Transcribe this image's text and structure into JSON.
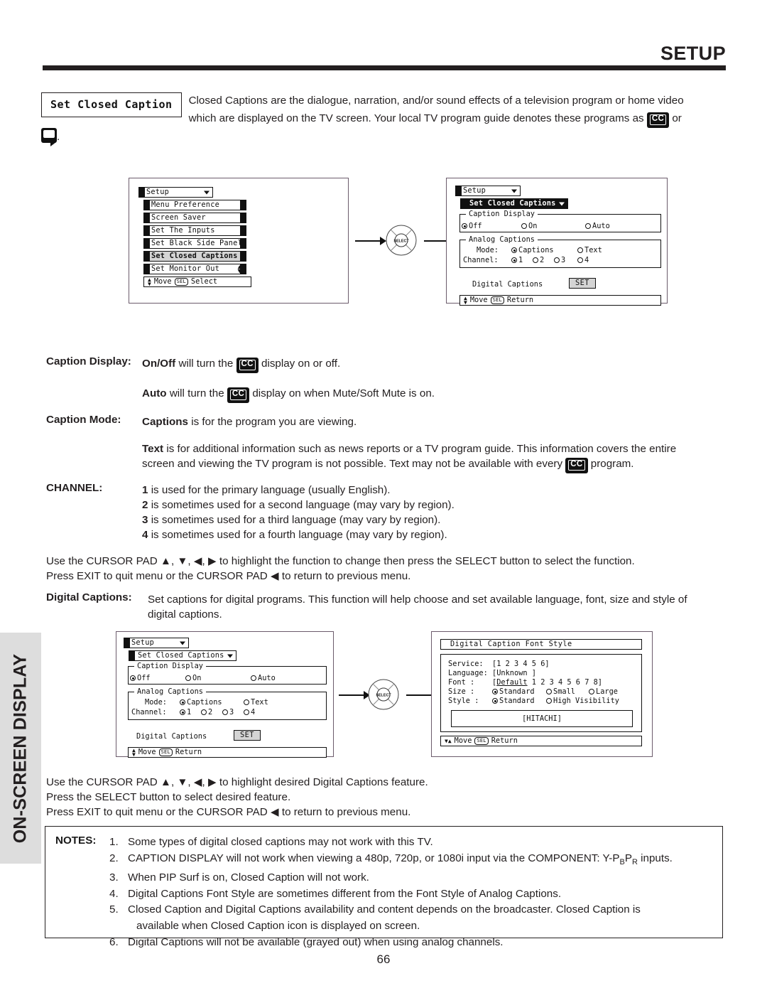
{
  "header": {
    "title": "SETUP"
  },
  "side_tab": {
    "label": "ON-SCREEN DISPLAY"
  },
  "page_number": "66",
  "intro": {
    "tag_label": "Set Closed Caption",
    "line1": "Closed Captions are the dialogue, narration, and/or sound effects of a television program or home video",
    "line2_a": "which are displayed on the TV screen.  Your local TV program guide denotes these programs as",
    "cc_badge": "CC",
    "line2_b": "or",
    "line3_b": "."
  },
  "diagram1": {
    "menu": {
      "title": "Setup",
      "items": [
        "Menu Preference",
        "Screen Saver",
        "Set The Inputs",
        "Set Black Side Panel",
        "Set Closed Captions",
        "Set Monitor Out"
      ],
      "selected_item": "Set Closed Captions",
      "footer_move": "Move",
      "footer_key": "SEL",
      "footer_action": "Select"
    },
    "pad_label": "SELECT"
  },
  "diagram2": {
    "title": "Setup",
    "subtitle": "Set Closed Captions",
    "caption_display": {
      "legend": "Caption Display",
      "options": [
        "Off",
        "On",
        "Auto"
      ],
      "selected": "Off"
    },
    "analog_captions": {
      "legend": "Analog Captions",
      "mode_label": "Mode:",
      "mode_options": [
        "Captions",
        "Text"
      ],
      "mode_selected": "Captions",
      "channel_label": "Channel:",
      "channel_options": [
        "1",
        "2",
        "3",
        "4"
      ],
      "channel_selected": "1"
    },
    "digital_captions_label": "Digital Captions",
    "digital_captions_button": "SET",
    "footer_move": "Move",
    "footer_key": "SEL",
    "footer_action": "Return"
  },
  "explain": {
    "caption_display_label": "Caption Display:",
    "caption_display_l1_a": "On/Off",
    "caption_display_l1_b": "will turn the",
    "caption_display_l1_c": "display on or off.",
    "auto_a": "Auto",
    "auto_b": "will turn the",
    "auto_c": "display on when Mute/Soft Mute is on.",
    "caption_mode_label": "Caption Mode:",
    "captions_a": "Captions",
    "captions_b": "is for the program you are viewing.",
    "text_a": "Text",
    "text_b": "is for additional information such as news reports or a TV program guide.  This information covers the entire",
    "text_c": "screen and viewing the TV program is not possible.  Text may not be available with every",
    "text_d": "program.",
    "channel_label": "CHANNEL:",
    "channel_lines": [
      {
        "num": "1",
        "text": "is used for the primary language (usually English)."
      },
      {
        "num": "2",
        "text": "is sometimes used for a second language (may vary by region)."
      },
      {
        "num": "3",
        "text": "is sometimes used for a third language (may vary by region)."
      },
      {
        "num": "4",
        "text": "is sometimes used for a fourth language (may vary by region)."
      }
    ],
    "cursor_line1": "Use the CURSOR PAD ▲, ▼, ◀, ▶ to highlight the function to change then press the SELECT button to select the function.",
    "cursor_line2": "Press EXIT to quit menu or the CURSOR PAD ◀ to return to previous menu.",
    "digital_captions_label": "Digital Captions:",
    "digital_captions_l1": "Set captions for digital programs.  This function will help choose and set  available language, font, size and style of",
    "digital_captions_l2": "digital captions."
  },
  "diagram3": {
    "title": "Setup",
    "subtitle": "Set Closed Captions",
    "caption_display": {
      "legend": "Caption Display",
      "options": [
        "Off",
        "On",
        "Auto"
      ],
      "selected": "Off"
    },
    "analog_captions": {
      "legend": "Analog Captions",
      "mode_label": "Mode:",
      "mode_options": [
        "Captions",
        "Text"
      ],
      "mode_selected": "Captions",
      "channel_label": "Channel:",
      "channel_options": [
        "1",
        "2",
        "3",
        "4"
      ],
      "channel_selected": "1"
    },
    "digital_captions_label": "Digital Captions",
    "digital_captions_button": "SET",
    "footer_move": "Move",
    "footer_key": "SEL",
    "footer_action": "Return"
  },
  "diagram4": {
    "title": "Digital Caption Font Style",
    "rows": {
      "service_label": "Service:",
      "service_value": "[1 2 3 4 5 6]",
      "language_label": "Language:",
      "language_value": "[Unknown    ]",
      "font_label": "Font    :",
      "font_value_open": "[",
      "font_default": "Default",
      "font_value_rest": " 1 2 3 4 5 6 7 8]",
      "size_label": "Size    :",
      "size_options": [
        "Standard",
        "Small",
        "Large"
      ],
      "size_selected": "Standard",
      "style_label": "Style   :",
      "style_options": [
        "Standard",
        "High Visibility"
      ],
      "style_selected": "Standard"
    },
    "preview": "[HITACHI]",
    "footer_move": "Move",
    "footer_key": "SEL",
    "footer_action": "Return"
  },
  "cursor_block2": {
    "line1": "Use the CURSOR PAD ▲, ▼, ◀, ▶ to highlight desired Digital Captions feature.",
    "line2": "Press the SELECT button to select desired feature.",
    "line3": "Press EXIT to quit menu or the CURSOR PAD ◀ to return to previous menu."
  },
  "notes": {
    "label": "NOTES:",
    "items": [
      {
        "num": "1.",
        "pre": "Some types of digital closed captions may not work with this TV.",
        "sub_b": "",
        "mid": "",
        "sub_r": "",
        "post": ""
      },
      {
        "num": "2.",
        "pre": "CAPTION DISPLAY will not work when viewing a 480p, 720p, or 1080i input via the COMPONENT: Y-P",
        "sub_b": "B",
        "mid": "P",
        "sub_r": "R",
        "post": " inputs."
      },
      {
        "num": "3.",
        "pre": "When PIP Surf is on, Closed Caption will not work.",
        "sub_b": "",
        "mid": "",
        "sub_r": "",
        "post": ""
      },
      {
        "num": "4.",
        "pre": "Digital Captions Font Style are sometimes different from the Font Style of Analog Captions.",
        "sub_b": "",
        "mid": "",
        "sub_r": "",
        "post": ""
      },
      {
        "num": "5.",
        "pre": "Closed Caption and Digital Captions availability and content depends on the broadcaster.  Closed Caption is",
        "sub_b": "",
        "mid": "",
        "sub_r": "",
        "post": ""
      },
      {
        "num": "",
        "pre": "available when Closed Caption icon is displayed on screen.",
        "sub_b": "",
        "mid": "",
        "sub_r": "",
        "post": ""
      },
      {
        "num": "6.",
        "pre": "Digital Captions will not be available (grayed out) when using analog channels.",
        "sub_b": "",
        "mid": "",
        "sub_r": "",
        "post": ""
      }
    ]
  }
}
